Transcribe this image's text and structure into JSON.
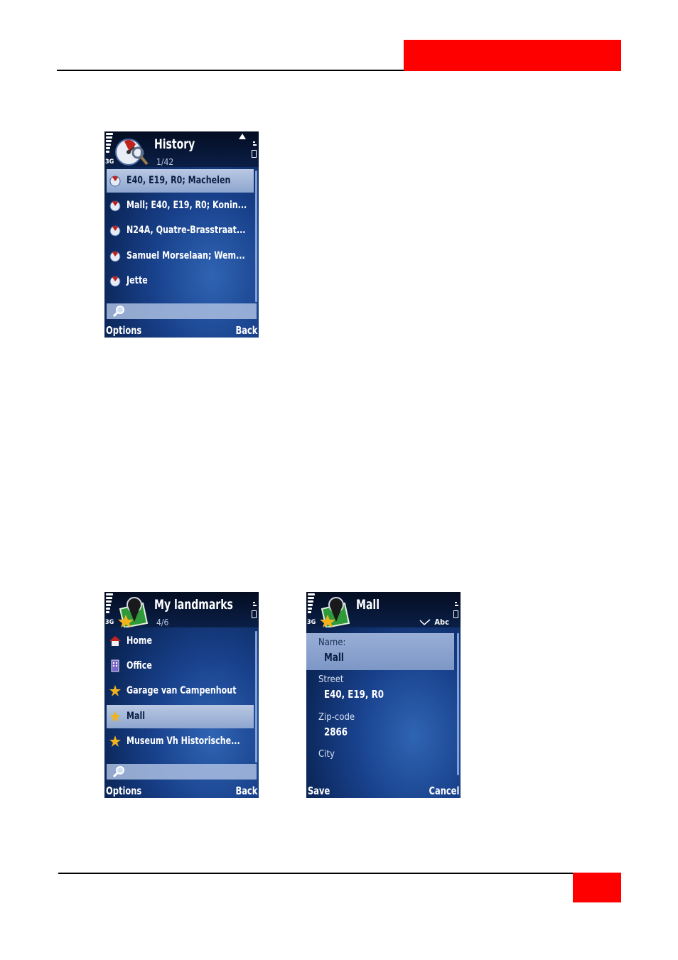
{
  "screens": {
    "history": {
      "title": "History",
      "count": "1/42",
      "network": "3G",
      "items": [
        {
          "label": "E40, E19, R0; Machelen"
        },
        {
          "label": "Mall; E40, E19, R0; Konin..."
        },
        {
          "label": "N24A, Quatre-Brasstraat..."
        },
        {
          "label": "Samuel Morselaan; Wem..."
        },
        {
          "label": "Jette"
        }
      ],
      "softkeys": {
        "left": "Options",
        "right": "Back"
      }
    },
    "landmarks": {
      "title": "My landmarks",
      "count": "4/6",
      "network": "3G",
      "items": [
        {
          "label": "Home",
          "icon": "house-icon"
        },
        {
          "label": "Office",
          "icon": "office-building-icon"
        },
        {
          "label": "Garage van Campenhout",
          "icon": "star-icon"
        },
        {
          "label": "Mall",
          "icon": "star-icon"
        },
        {
          "label": "Museum Vh Historische...",
          "icon": "star-icon"
        }
      ],
      "softkeys": {
        "left": "Options",
        "right": "Back"
      }
    },
    "mall": {
      "title": "Mall",
      "network": "3G",
      "input_mode": "Abc",
      "fields": [
        {
          "label": "Name:",
          "value": "Mall"
        },
        {
          "label": "Street",
          "value": "E40, E19, R0"
        },
        {
          "label": "Zip-code",
          "value": "2866"
        },
        {
          "label": "City",
          "value": ""
        }
      ],
      "softkeys": {
        "left": "Save",
        "right": "Cancel"
      }
    }
  },
  "colors": {
    "accent": "#ff0000",
    "rule": "#000000"
  }
}
